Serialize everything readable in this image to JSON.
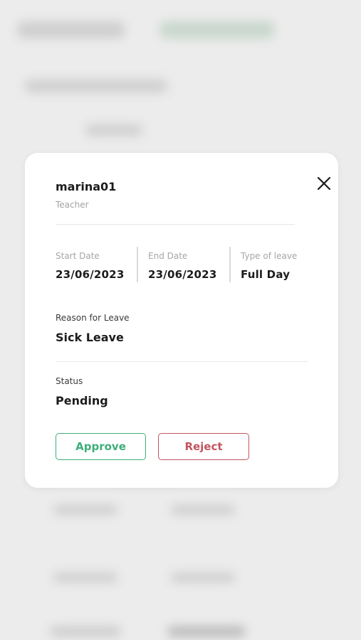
{
  "leave_request": {
    "user_name": "marina01",
    "role": "Teacher",
    "start_date_label": "Start Date",
    "start_date": "23/06/2023",
    "end_date_label": "End Date",
    "end_date": "23/06/2023",
    "type_label": "Type of leave",
    "type": "Full Day",
    "reason_label": "Reason for Leave",
    "reason": "Sick Leave",
    "status_label": "Status",
    "status": "Pending"
  },
  "actions": {
    "approve_label": "Approve",
    "reject_label": "Reject"
  },
  "colors": {
    "approve": "#3fae7a",
    "reject": "#c25560",
    "backdrop": "#ececec"
  },
  "icons": {
    "close": "close-icon"
  }
}
